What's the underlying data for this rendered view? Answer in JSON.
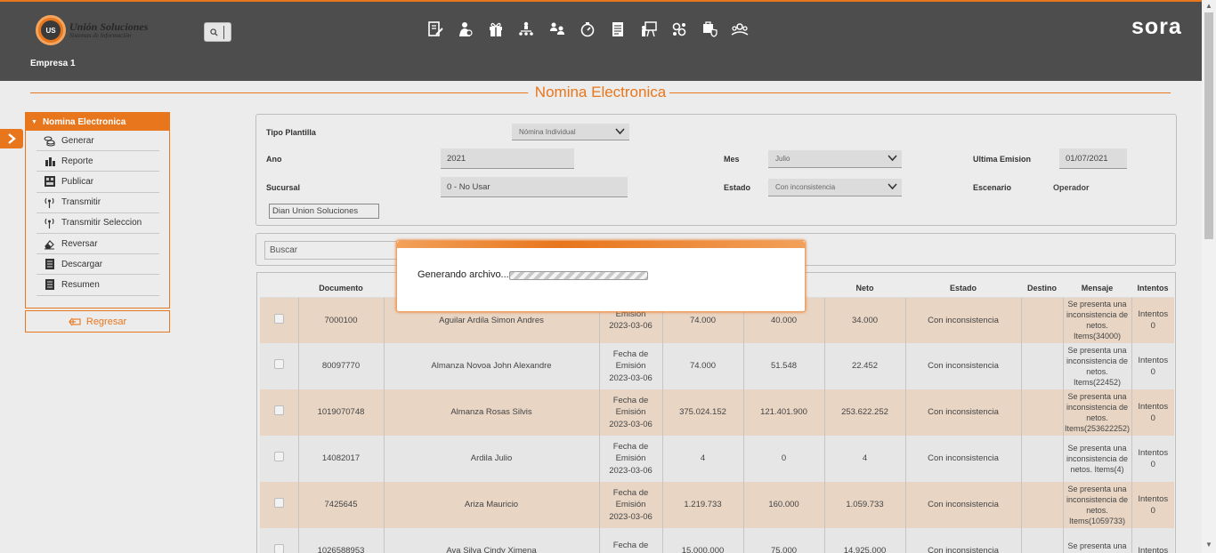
{
  "header": {
    "logo_title": "Unión Soluciones",
    "logo_subtitle": "Sistemas de Información",
    "logo_mark": "US",
    "company": "Empresa 1",
    "brand": "sora",
    "nav_icons": [
      "document-edit-icon",
      "employee-icon",
      "gift-icon",
      "org-chart-icon",
      "transfer-icon",
      "stopwatch-icon",
      "report-icon",
      "training-icon",
      "network-icon",
      "shield-icon",
      "group-icon"
    ]
  },
  "page_title": "Nomina Electronica",
  "sidebar": {
    "title": "Nomina Electronica",
    "items": [
      {
        "label": "Generar",
        "icon": "coins-icon"
      },
      {
        "label": "Reporte",
        "icon": "bar-chart-icon"
      },
      {
        "label": "Publicar",
        "icon": "publish-icon"
      },
      {
        "label": "Transmitir",
        "icon": "antenna-icon"
      },
      {
        "label": "Transmitir Seleccion",
        "icon": "antenna-icon"
      },
      {
        "label": "Reversar",
        "icon": "eraser-icon"
      },
      {
        "label": "Descargar",
        "icon": "document-icon"
      },
      {
        "label": "Resumen",
        "icon": "document-icon"
      }
    ],
    "back_label": "Regresar"
  },
  "form": {
    "tipo_plantilla_label": "Tipo Plantilla",
    "tipo_plantilla_value": "Nómina Individual",
    "ano_label": "Ano",
    "ano_value": "2021",
    "mes_label": "Mes",
    "mes_value": "Julio",
    "ultima_emision_label": "Ultima Emision",
    "ultima_emision_value": "01/07/2021",
    "sucursal_label": "Sucursal",
    "sucursal_value": "0 - No Usar",
    "estado_label": "Estado",
    "estado_value": "Con inconsistencia",
    "escenario_label": "Escenario",
    "escenario_value": "Operador",
    "operador_value": "Dian Union Soluciones"
  },
  "search": {
    "placeholder": "Buscar"
  },
  "table": {
    "headers": [
      "",
      "Documento",
      "",
      "",
      "",
      "",
      "Neto",
      "Estado",
      "Destino",
      "Mensaje",
      "Intentos"
    ],
    "rows": [
      {
        "doc": "7000100",
        "name": "Aguilar Ardila Simon Andres",
        "fecha_label": "Emisión",
        "fecha": "2023-03-06",
        "dev": "74.000",
        "ded": "40.000",
        "neto": "34.000",
        "estado": "Con inconsistencia",
        "msg": "Se presenta una inconsistencia de netos. Items(34000)",
        "intentos": "Intentos",
        "count": "0"
      },
      {
        "doc": "80097770",
        "name": "Almanza Novoa John Alexandre",
        "fecha_label": "Fecha de Emisión",
        "fecha": "2023-03-06",
        "dev": "74.000",
        "ded": "51.548",
        "neto": "22.452",
        "estado": "Con inconsistencia",
        "msg": "Se presenta una inconsistencia de netos. Items(22452)",
        "intentos": "Intentos",
        "count": "0"
      },
      {
        "doc": "1019070748",
        "name": "Almanza Rosas Silvis",
        "fecha_label": "Fecha de Emisión",
        "fecha": "2023-03-06",
        "dev": "375.024.152",
        "ded": "121.401.900",
        "neto": "253.622.252",
        "estado": "Con inconsistencia",
        "msg": "Se presenta una inconsistencia de netos. Items(253622252)",
        "intentos": "Intentos",
        "count": "0"
      },
      {
        "doc": "14082017",
        "name": "Ardila Julio",
        "fecha_label": "Fecha de Emisión",
        "fecha": "2023-03-06",
        "dev": "4",
        "ded": "0",
        "neto": "4",
        "estado": "Con inconsistencia",
        "msg": "Se presenta una inconsistencia de netos. Items(4)",
        "intentos": "Intentos",
        "count": "0"
      },
      {
        "doc": "7425645",
        "name": "Ariza Mauricio",
        "fecha_label": "Fecha de Emisión",
        "fecha": "2023-03-06",
        "dev": "1.219.733",
        "ded": "160.000",
        "neto": "1.059.733",
        "estado": "Con inconsistencia",
        "msg": "Se presenta una inconsistencia de netos. Items(1059733)",
        "intentos": "Intentos",
        "count": "0"
      },
      {
        "doc": "1026588953",
        "name": "Ava Silva Cindy Ximena",
        "fecha_label": "Fecha de Emisión",
        "fecha": "",
        "dev": "15.000.000",
        "ded": "75.000",
        "neto": "14.925.000",
        "estado": "Con inconsistencia",
        "msg": "Se presenta una inconsistencia de",
        "intentos": "Intentos",
        "count": ""
      }
    ]
  },
  "modal": {
    "text": "Generando archivo....",
    "progress": 1.0
  },
  "colors": {
    "accent": "#e8761c",
    "header_bg": "#4d4d4d",
    "row_odd": "#e8d5c4",
    "row_even": "#e6e6e6"
  }
}
